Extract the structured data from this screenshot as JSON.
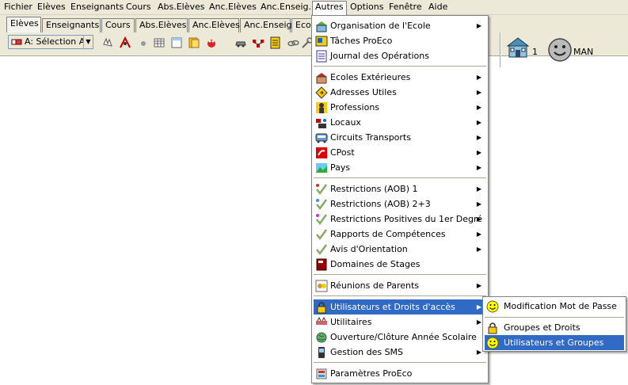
{
  "menubar": {
    "items": [
      "Fichier",
      "Elèves",
      "Enseignants",
      "Cours",
      "Abs.Elèves",
      "Anc.Elèves",
      "Anc.Enseig.",
      "Autres",
      "Options",
      "Fenêtre",
      "Aide"
    ],
    "active": "Autres"
  },
  "tabs": [
    "Elèves",
    "Enseignants",
    "Cours",
    "Abs.Elèves",
    "Anc.Elèves",
    "Anc.Enseig",
    "Ecol"
  ],
  "toolbar": {
    "selection_label": "A: Sélection A",
    "school_count": "1",
    "user_name": "MAN"
  },
  "menu": {
    "items": [
      "Organisation de l'Ecole",
      "Tâches ProEco",
      "Journal des Opérations",
      "Ecoles Extérieures",
      "Adresses Utiles",
      "Professions",
      "Locaux",
      "Circuits Transports",
      "CPost",
      "Pays",
      "Restrictions (AOB) 1",
      "Restrictions (AOB) 2+3",
      "Restrictions Positives du 1er Degré",
      "Rapports de Compétences",
      "Avis d'Orientation",
      "Domaines de Stages",
      "Réunions de Parents",
      "Utilisateurs et Droits d'accès",
      "Utilitaires",
      "Ouverture/Clôture Année Scolaire",
      "Gestion des SMS",
      "Paramètres ProEco"
    ]
  },
  "submenu": {
    "items": [
      "Modification Mot de Passe",
      "Groupes et Droits",
      "Utilisateurs et Groupes"
    ]
  },
  "colors": {
    "highlight": "#316ac5",
    "menubar_bg": "#ece9d8"
  }
}
